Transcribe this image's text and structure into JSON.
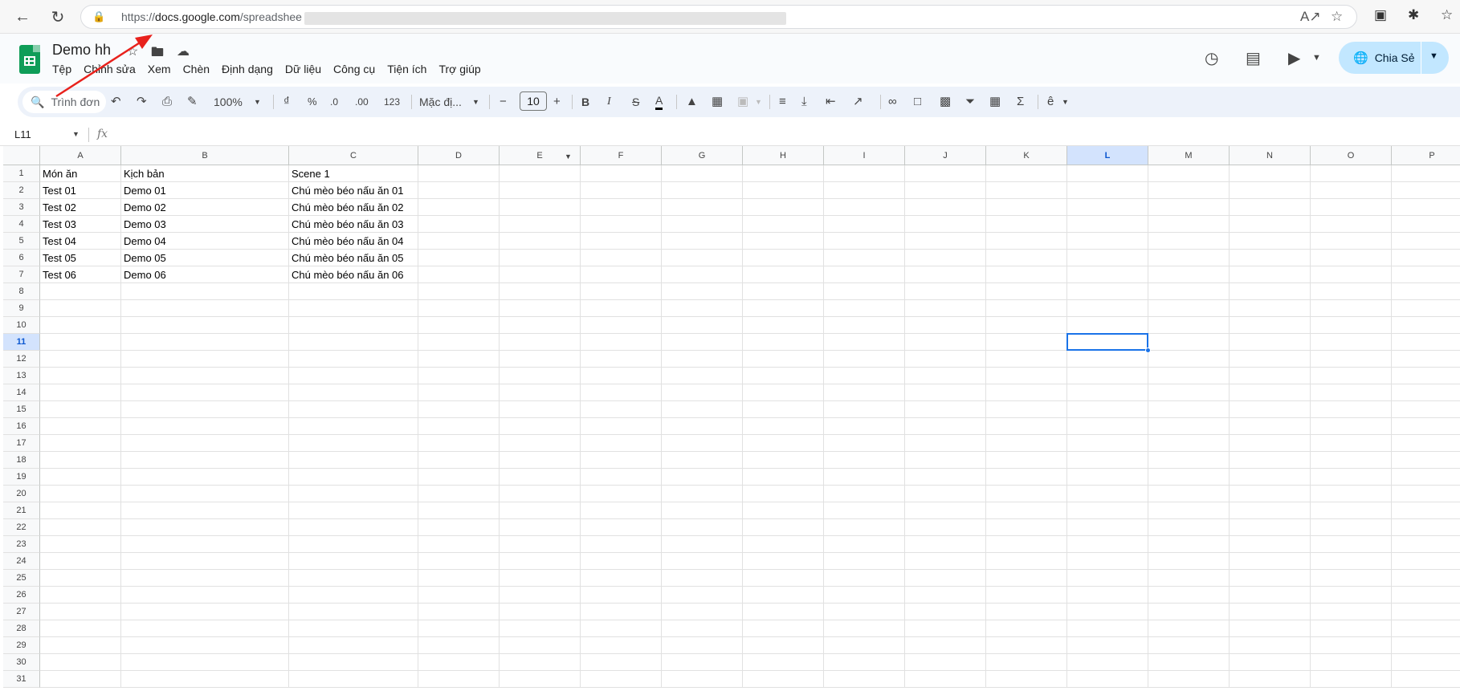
{
  "browser": {
    "url_prefix": "https://",
    "url_domain": "docs.google.com",
    "url_path": "/spreadshee"
  },
  "header": {
    "title": "Demo hh",
    "menu": [
      "Tệp",
      "Chỉnh sửa",
      "Xem",
      "Chèn",
      "Định dạng",
      "Dữ liệu",
      "Công cụ",
      "Tiện ích",
      "Trợ giúp"
    ],
    "share_label": "Chia Sẻ"
  },
  "toolbar": {
    "search_placeholder": "Trình đơn",
    "zoom": "100%",
    "currency": "₫",
    "percent": "%",
    "decimal_decrease": ".0",
    "decimal_increase": ".00",
    "number_format": "123",
    "font": "Mặc đị...",
    "font_size": "10",
    "bold": "B",
    "italic": "I",
    "strikethrough": "S",
    "text_color": "A",
    "sum": "Σ"
  },
  "formula_bar": {
    "name_box": "L11",
    "fx": "fx"
  },
  "sheet": {
    "columns": [
      "A",
      "B",
      "C",
      "D",
      "E",
      "F",
      "G",
      "H",
      "I",
      "J",
      "K",
      "L",
      "M",
      "N",
      "O",
      "P"
    ],
    "row_numbers": [
      "1",
      "2",
      "3",
      "4",
      "5",
      "6",
      "7",
      "8",
      "9",
      "10",
      "11",
      "12",
      "13",
      "14",
      "15",
      "16",
      "17",
      "18",
      "19",
      "20",
      "21",
      "22",
      "23",
      "24",
      "25",
      "26",
      "27",
      "28",
      "29",
      "30",
      "31"
    ],
    "selected_cell": "L11",
    "rows": [
      [
        "Món ăn",
        "Kịch bản",
        "Scene 1"
      ],
      [
        "Test 01",
        "Demo 01",
        "Chú mèo béo nấu ăn 01"
      ],
      [
        "Test 02",
        "Demo 02",
        "Chú mèo béo nấu ăn 02"
      ],
      [
        "Test 03",
        "Demo 03",
        "Chú mèo béo nấu ăn 03"
      ],
      [
        "Test 04",
        "Demo 04",
        "Chú mèo béo nấu ăn 04"
      ],
      [
        "Test 05",
        "Demo 05",
        "Chú mèo béo nấu ăn 05"
      ],
      [
        "Test 06",
        "Demo 06",
        "Chú mèo béo nấu ăn 06"
      ]
    ]
  },
  "colors": {
    "accent": "#1a73e8",
    "annotation": "#e8211c",
    "sheets_green": "#0f9d58",
    "share_bg": "#c2e7ff"
  }
}
